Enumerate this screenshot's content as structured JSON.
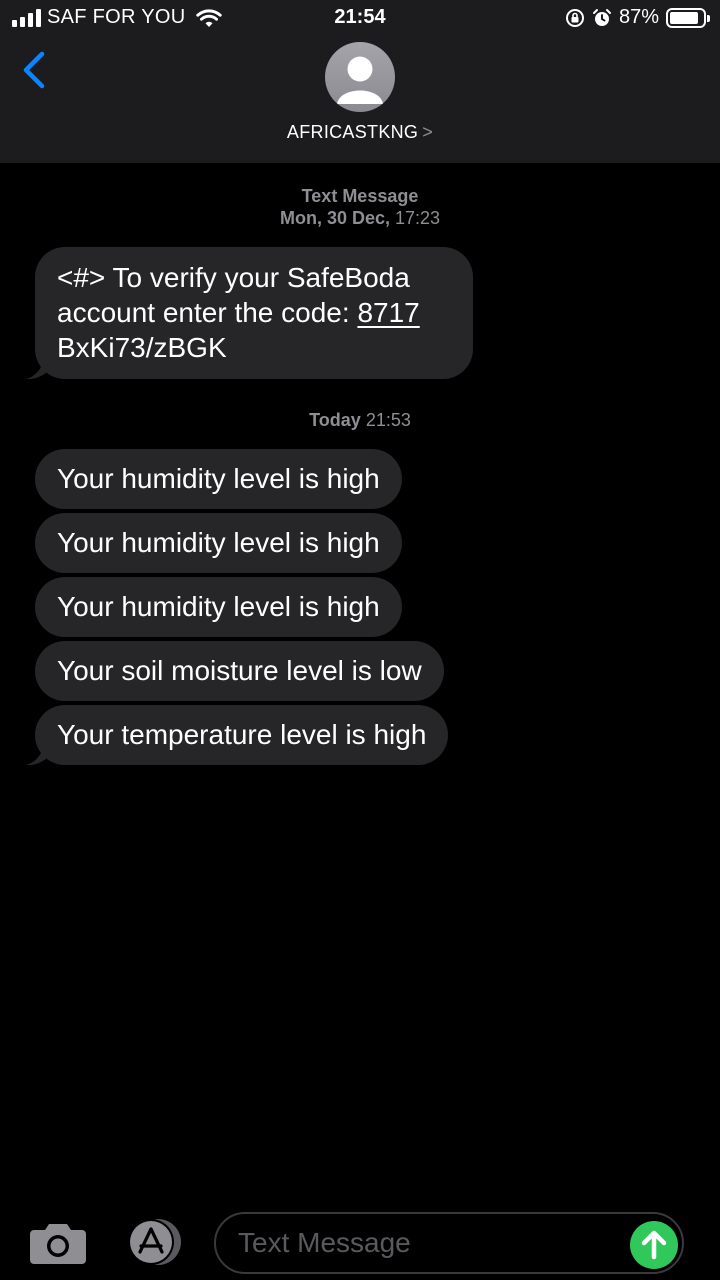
{
  "status_bar": {
    "carrier": "SAF FOR YOU",
    "time": "21:54",
    "battery": "87%",
    "battery_level": 0.87
  },
  "header": {
    "contact_name": "AFRICASTKNG",
    "contact_chevron": ">"
  },
  "thread": {
    "first_group": {
      "type_label": "Text Message",
      "date_bold": "Mon, 30 Dec,",
      "time": "17:23"
    },
    "otp_message": {
      "text_before": "<#> To verify your SafeBoda account enter the code: ",
      "code": "8717",
      "text_after": " BxKi73/zBGK"
    },
    "second_group": {
      "date_bold": "Today",
      "time": "21:53"
    },
    "messages": [
      "Your humidity level is high",
      "Your humidity level is high",
      "Your humidity level is high",
      "Your soil moisture level is low",
      "Your temperature level is high"
    ]
  },
  "composer": {
    "placeholder": "Text Message"
  },
  "icons": {
    "back": "chevron-left-icon",
    "avatar": "person-silhouette",
    "camera": "camera-icon",
    "apps": "app-store-icon",
    "send": "arrow-up-icon"
  },
  "colors": {
    "accent": "#0a84ff",
    "send": "#30c85a",
    "bubble": "#262629",
    "header": "#1c1c1e",
    "meta": "#8e8e93"
  }
}
